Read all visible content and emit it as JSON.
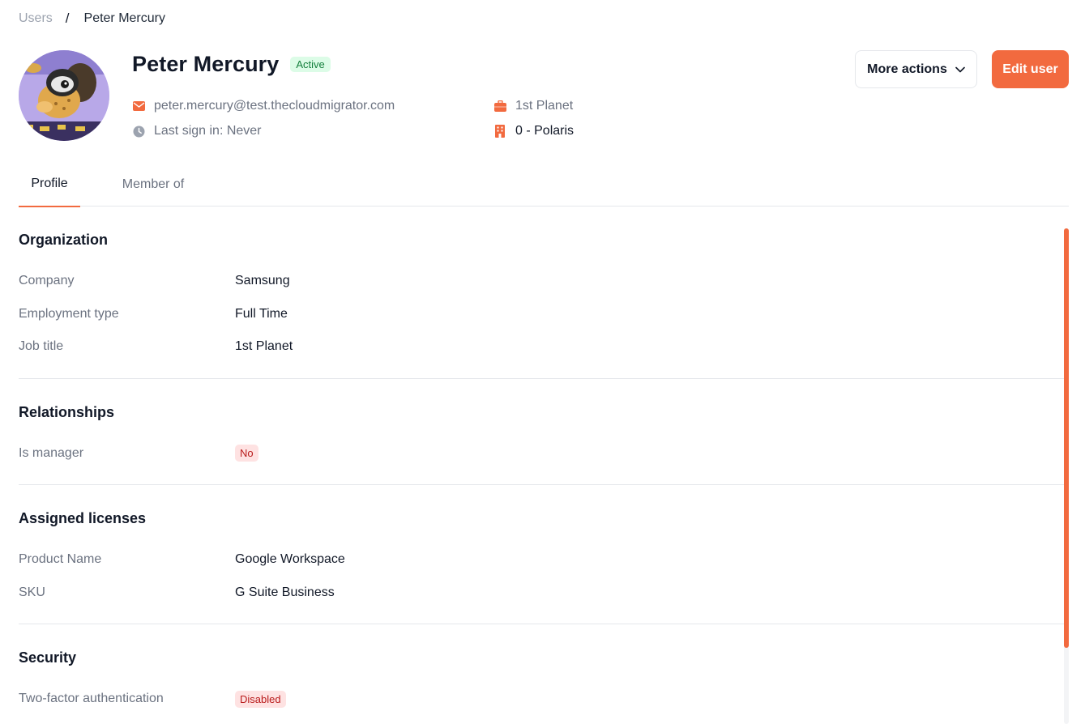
{
  "breadcrumb": {
    "parent": "Users",
    "separator": "/",
    "current": "Peter Mercury"
  },
  "user": {
    "name": "Peter Mercury",
    "status": "Active",
    "email": "peter.mercury@test.thecloudmigrator.com",
    "last_sign_in": "Last sign in: Never",
    "job_title": "1st Planet",
    "location": "0 - Polaris"
  },
  "actions": {
    "more_label": "More actions",
    "edit_label": "Edit user"
  },
  "tabs": [
    {
      "label": "Profile",
      "active": true
    },
    {
      "label": "Member of",
      "active": false
    }
  ],
  "sections": {
    "organization": {
      "title": "Organization",
      "rows": [
        {
          "label": "Company",
          "value": "Samsung"
        },
        {
          "label": "Employment type",
          "value": "Full Time"
        },
        {
          "label": "Job title",
          "value": "1st Planet"
        }
      ]
    },
    "relationships": {
      "title": "Relationships",
      "rows": [
        {
          "label": "Is manager",
          "value": "No"
        }
      ]
    },
    "licenses": {
      "title": "Assigned licenses",
      "rows": [
        {
          "label": "Product Name",
          "value": "Google Workspace"
        },
        {
          "label": "SKU",
          "value": "G Suite Business"
        }
      ]
    },
    "security": {
      "title": "Security",
      "rows": [
        {
          "label": "Two-factor authentication",
          "value": "Disabled"
        }
      ]
    }
  },
  "icons": {
    "email": "envelope-icon",
    "last_sign_in": "clock-icon",
    "job_title": "briefcase-icon",
    "location": "building-icon",
    "more": "chevron-down-icon"
  },
  "colors": {
    "accent": "#f26a3f",
    "active_bg": "#dcfce7",
    "active_text": "#15803d",
    "danger_bg": "#fee2e2",
    "danger_text": "#b91c1c"
  }
}
